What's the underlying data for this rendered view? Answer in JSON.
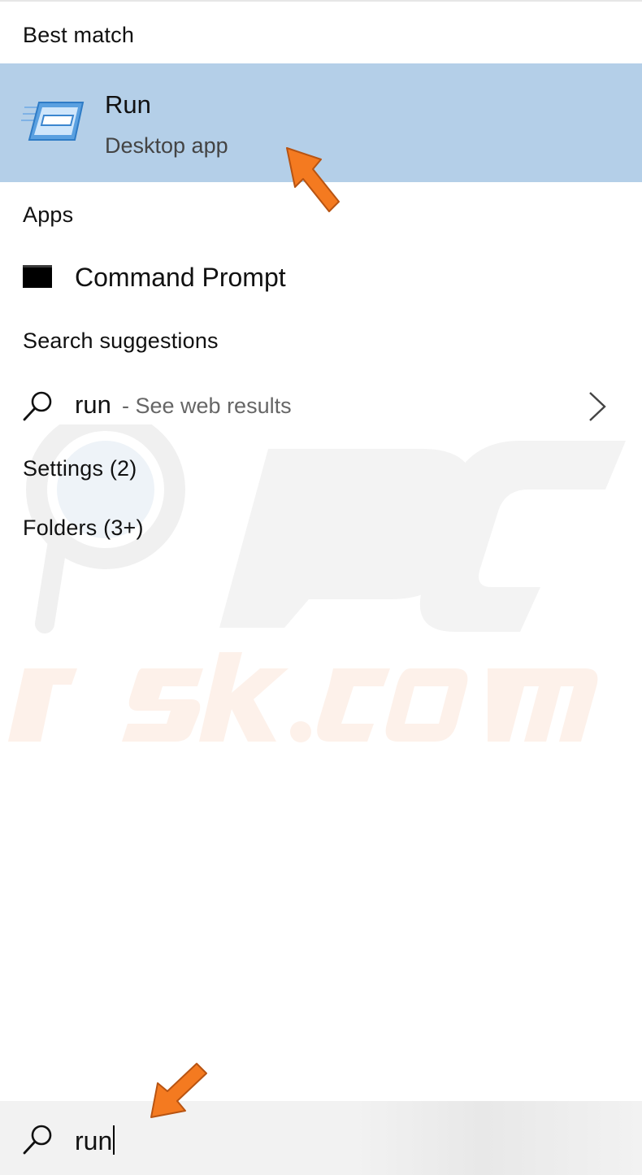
{
  "results": {
    "best_match": {
      "header": "Best match",
      "title": "Run",
      "subtitle": "Desktop app",
      "icon": "run-dialog-icon"
    },
    "apps": {
      "header": "Apps",
      "items": [
        {
          "label": "Command Prompt",
          "icon": "command-prompt-icon"
        }
      ]
    },
    "search_suggestions": {
      "header": "Search suggestions",
      "items": [
        {
          "query": "run",
          "hint": "- See web results",
          "icon": "search-icon"
        }
      ]
    },
    "settings": {
      "header": "Settings (2)"
    },
    "folders": {
      "header": "Folders (3+)"
    }
  },
  "search_box": {
    "value": "run",
    "icon": "search-icon"
  },
  "colors": {
    "selected_row": "#b4cfe8",
    "annotation_arrow": "#f47a20"
  }
}
